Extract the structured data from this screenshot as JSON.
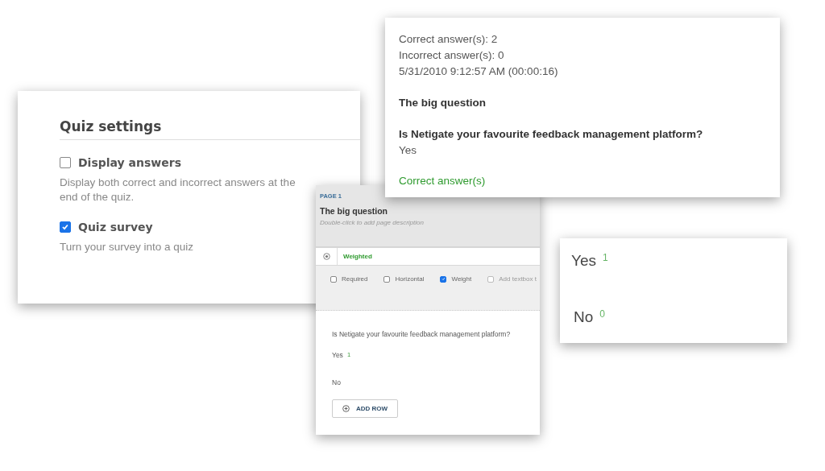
{
  "quiz_settings": {
    "title": "Quiz settings",
    "options": [
      {
        "label": "Display answers",
        "checked": false,
        "description": "Display both correct and incorrect answers at the end of the quiz."
      },
      {
        "label": "Quiz survey",
        "checked": true,
        "description": "Turn your survey into a quiz"
      }
    ]
  },
  "results": {
    "lines": [
      "Correct answer(s): 2",
      "Incorrect answer(s): 0",
      "5/31/2010 9:12:57 AM (00:00:16)"
    ],
    "page_title": "The big question",
    "question": "Is Netigate your favourite feedback management platform?",
    "answer": "Yes",
    "verdict": "Correct answer(s)"
  },
  "editor": {
    "page_label": "PAGE 1",
    "page_title": "The big question",
    "page_description": "Double-click to add page description",
    "question_type": "Weighted",
    "options": [
      {
        "label": "Required",
        "checked": false,
        "disabled": false
      },
      {
        "label": "Horizontal",
        "checked": false,
        "disabled": false
      },
      {
        "label": "Weight",
        "checked": true,
        "disabled": false
      },
      {
        "label": "Add textbox t",
        "checked": false,
        "disabled": true
      }
    ],
    "question": "Is Netigate your favourite feedback management platform?",
    "rows": [
      {
        "label": "Yes",
        "weight": "1"
      },
      {
        "label": "No"
      }
    ],
    "add_row": "ADD ROW"
  },
  "weights": {
    "rows": [
      {
        "label": "Yes",
        "weight": "1"
      },
      {
        "label": "No",
        "weight": "0"
      }
    ]
  }
}
